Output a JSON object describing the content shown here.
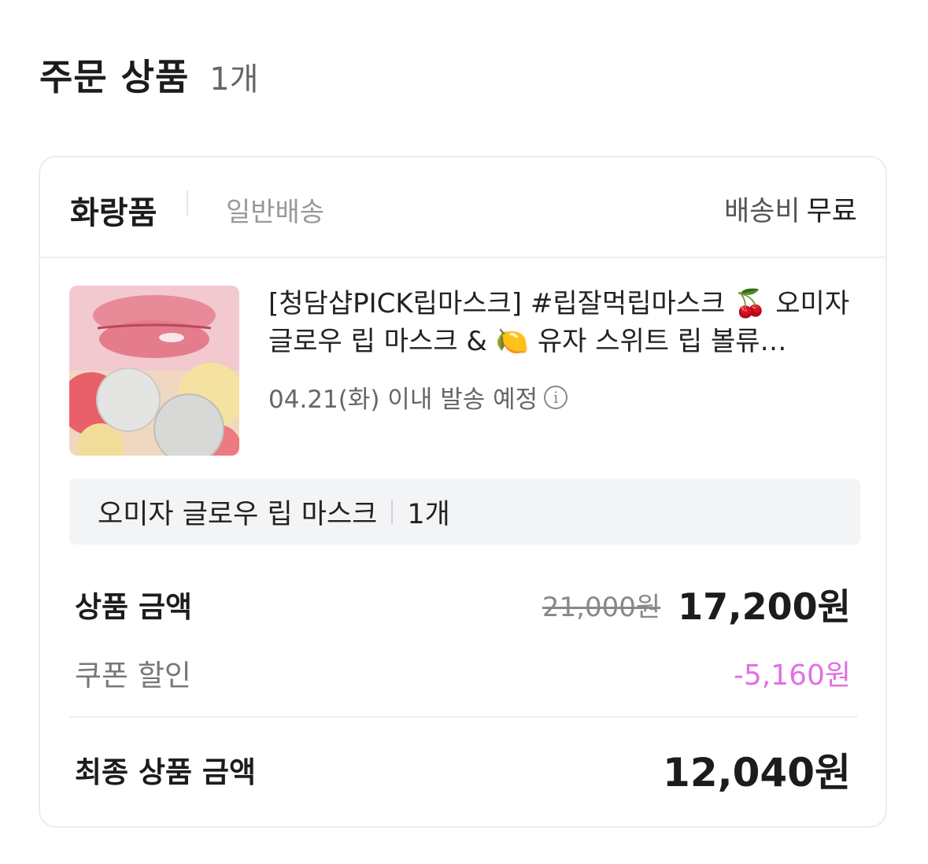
{
  "header": {
    "title": "주문 상품",
    "count": "1개"
  },
  "card": {
    "seller": "화랑품",
    "shipping_type": "일반배송",
    "shipping_fee_label": "배송비",
    "shipping_fee_value": "무료",
    "product": {
      "name": "[청담샵PICK립마스크] #립잘먹립마스크 🍒 오미자 글로우 립 마스크 & 🍋 유자 스위트 립 볼류…",
      "ship_date": "04.21(화) 이내 발송 예정",
      "info_icon": "info-icon"
    },
    "option": {
      "name": "오미자 글로우 립 마스크",
      "qty": "1개"
    },
    "summary": {
      "product_amount_label": "상품 금액",
      "original_price": "21,000원",
      "sale_price": "17,200원",
      "coupon_label": "쿠폰 할인",
      "coupon_value": "-5,160원",
      "final_label": "최종 상품 금액",
      "final_price": "12,040원"
    },
    "colors": {
      "discount": "#e36fe4"
    }
  }
}
